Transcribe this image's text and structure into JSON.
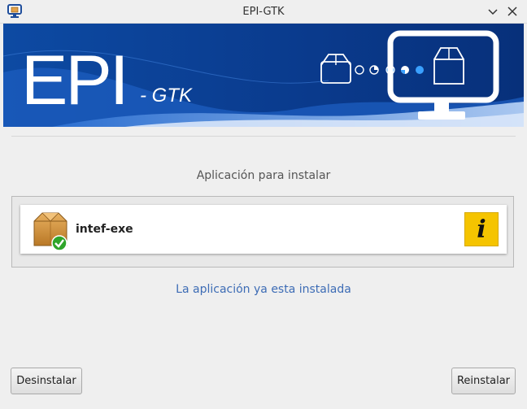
{
  "window": {
    "title": "EPI-GTK"
  },
  "banner": {
    "logo_main": "EPI",
    "logo_sub": "- GTK"
  },
  "main": {
    "subtitle": "Aplicación para instalar",
    "app": {
      "name": "intef-exe",
      "installed": true,
      "info_glyph": "i"
    },
    "status_message": "La aplicación ya esta instalada"
  },
  "actions": {
    "uninstall_label": "Desinstalar",
    "reinstall_label": "Reinstalar"
  },
  "colors": {
    "banner_blue": "#0a3d8f",
    "status_link": "#3d6cb5",
    "info_yellow": "#f5c400",
    "installed_green": "#2fa52a"
  }
}
